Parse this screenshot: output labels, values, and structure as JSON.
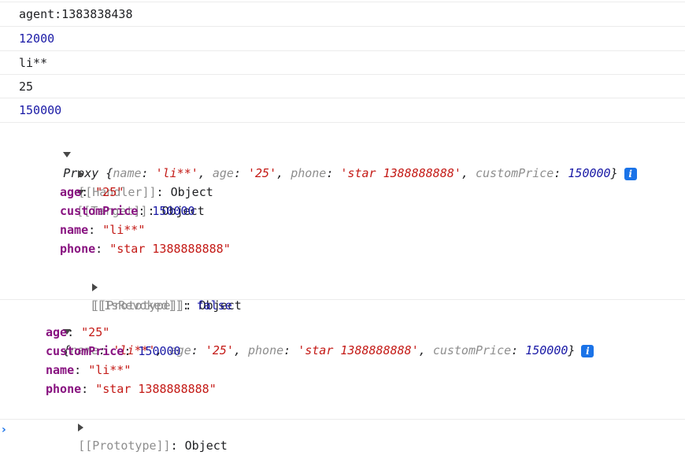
{
  "log_lines": [
    "agent:1383838438",
    "12000",
    "li**",
    "25",
    "150000"
  ],
  "proxy": {
    "label": "Proxy",
    "preview": {
      "name_key": "name",
      "name_val": "'li**'",
      "age_key": "age",
      "age_val": "'25'",
      "phone_key": "phone",
      "phone_val": "'star 1388888888'",
      "price_key": "customPrice",
      "price_val": "150000"
    },
    "handler_label": "[[Handler]]",
    "handler_type": "Object",
    "target_label": "[[Target]]",
    "target_type": "Object",
    "props": {
      "age": {
        "key": "age",
        "val": "\"25\""
      },
      "customPrice": {
        "key": "customPrice",
        "val": "150000"
      },
      "name": {
        "key": "name",
        "val": "\"li**\""
      },
      "phone": {
        "key": "phone",
        "val": "\"star 1388888888\""
      }
    },
    "prototype_label": "[[Prototype]]",
    "prototype_type": "Object",
    "revoked_label": "[[IsRevoked]]",
    "revoked_val": "false"
  },
  "object": {
    "preview": {
      "name_key": "name",
      "name_val": "'li**'",
      "age_key": "age",
      "age_val": "'25'",
      "phone_key": "phone",
      "phone_val": "'star 1388888888'",
      "price_key": "customPrice",
      "price_val": "150000"
    },
    "props": {
      "age": {
        "key": "age",
        "val": "\"25\""
      },
      "customPrice": {
        "key": "customPrice",
        "val": "150000"
      },
      "name": {
        "key": "name",
        "val": "\"li**\""
      },
      "phone": {
        "key": "phone",
        "val": "\"star 1388888888\""
      }
    },
    "prototype_label": "[[Prototype]]",
    "prototype_type": "Object"
  },
  "info_icon_glyph": "i",
  "prompt_glyph": "›"
}
